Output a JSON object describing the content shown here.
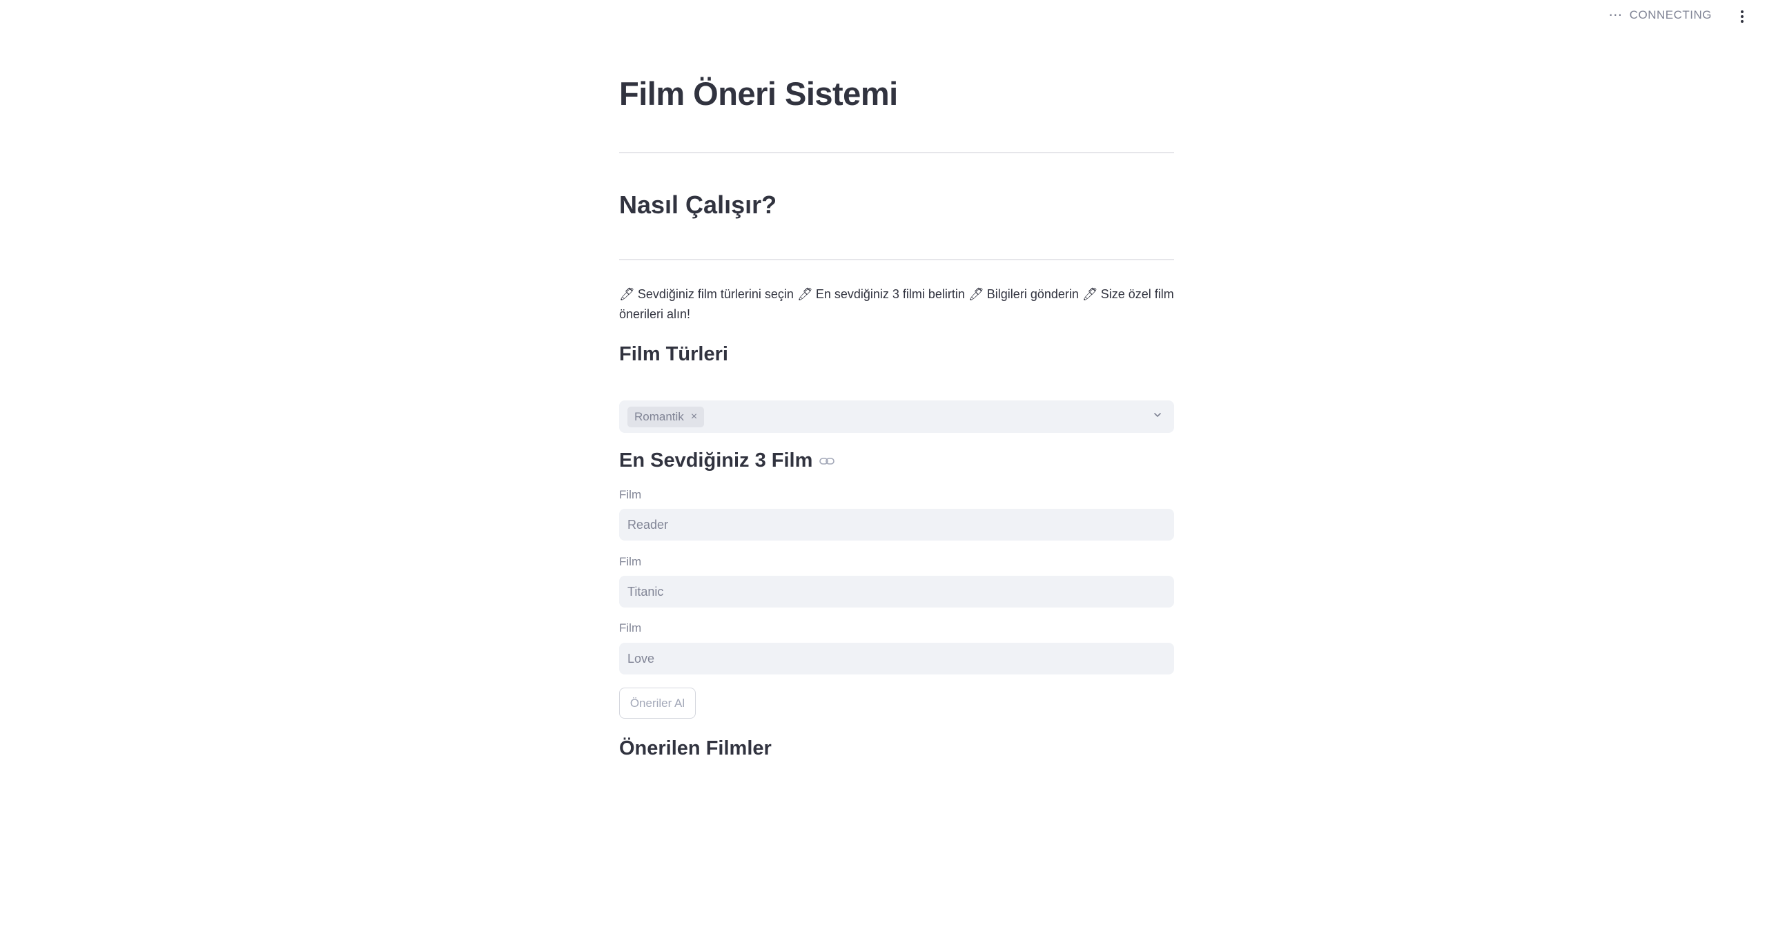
{
  "status": {
    "text": "CONNECTING",
    "icon": "ellipsis-icon"
  },
  "page": {
    "title": "Film Öneri Sistemi",
    "how_heading": "Nasıl Çalışır?",
    "steps": [
      "Sevdiğiniz film türlerini seçin",
      "En sevdiğiniz 3 filmi belirtin",
      "Bilgileri gönderin",
      "Size özel film önerileri alın!"
    ],
    "step_icon": "pen-icon"
  },
  "genres": {
    "heading": "Film Türleri",
    "selected": [
      "Romantik"
    ],
    "remove_glyph": "×"
  },
  "favorites": {
    "heading": "En Sevdiğiniz 3 Film",
    "fields": [
      {
        "label": "Film",
        "value": "Reader"
      },
      {
        "label": "Film",
        "value": "Titanic"
      },
      {
        "label": "Film",
        "value": "Love"
      }
    ],
    "submit_label": "Öneriler Al"
  },
  "results": {
    "heading": "Önerilen Filmler"
  },
  "colors": {
    "text": "#31333f",
    "muted": "#808495",
    "input_bg": "#f0f2f6"
  }
}
